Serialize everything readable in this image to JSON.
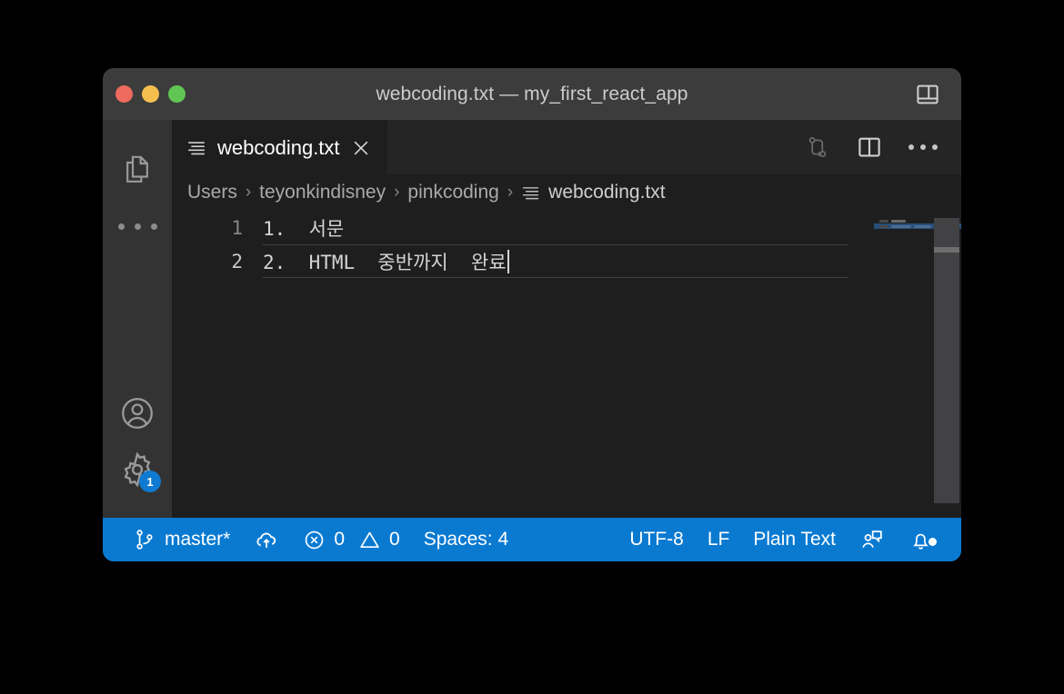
{
  "window": {
    "title": "webcoding.txt — my_first_react_app",
    "traffic_lights": [
      {
        "name": "close",
        "color": "#ed6a5e"
      },
      {
        "name": "minimize",
        "color": "#f5bf4f"
      },
      {
        "name": "maximize",
        "color": "#61c554"
      }
    ],
    "layout_toggle_icon": "panel-layout-icon"
  },
  "activity_bar": {
    "items": [
      {
        "name": "explorer",
        "icon": "files-icon"
      },
      {
        "name": "more-views",
        "icon": "ellipsis-icon"
      },
      {
        "name": "accounts",
        "icon": "account-icon"
      },
      {
        "name": "manage-settings",
        "icon": "gear-icon",
        "badge": "1"
      }
    ]
  },
  "tabs": {
    "active_index": 0,
    "items": [
      {
        "label": "webcoding.txt",
        "icon": "list-file-icon",
        "close_icon": "close-icon",
        "dirty": false
      }
    ],
    "actions": [
      {
        "name": "compare-changes",
        "icon": "source-control-compare-icon"
      },
      {
        "name": "split-editor",
        "icon": "split-editor-icon"
      },
      {
        "name": "more-actions",
        "icon": "ellipsis-icon"
      }
    ]
  },
  "breadcrumb": {
    "separator": "›",
    "items": [
      {
        "label": "Users",
        "icon": null
      },
      {
        "label": "teyonkindisney",
        "icon": null
      },
      {
        "label": "pinkcoding",
        "icon": null
      },
      {
        "label": "webcoding.txt",
        "icon": "list-file-icon"
      }
    ]
  },
  "editor": {
    "language": "Plain Text",
    "active_line": 2,
    "lines": [
      {
        "number": "1",
        "text": "1.  서문"
      },
      {
        "number": "2",
        "text": "2.  HTML  중반까지  완료"
      }
    ],
    "cursor": {
      "line": 2,
      "after_text": "2.  HTML  중반까지  완료"
    }
  },
  "minimap": {
    "selected_line": 2,
    "lines": [
      {
        "tokens": [
          14,
          22
        ]
      },
      {
        "tokens": [
          14,
          30,
          26,
          20
        ]
      }
    ]
  },
  "status_bar": {
    "left": [
      {
        "name": "branch",
        "icon": "source-control-branch-icon",
        "label": "master*"
      },
      {
        "name": "sync",
        "icon": "cloud-upload-icon",
        "label": ""
      },
      {
        "name": "problems",
        "icon": "error-warning-icon",
        "errors": "0",
        "warnings": "0"
      },
      {
        "name": "indentation",
        "icon": null,
        "label": "Spaces: 4"
      }
    ],
    "right": [
      {
        "name": "encoding",
        "icon": null,
        "label": "UTF-8"
      },
      {
        "name": "eol",
        "icon": null,
        "label": "LF"
      },
      {
        "name": "language-mode",
        "icon": null,
        "label": "Plain Text"
      },
      {
        "name": "feedback",
        "icon": "person-feedback-icon",
        "label": ""
      },
      {
        "name": "notifications",
        "icon": "bell-dot-icon",
        "label": ""
      }
    ],
    "background_color": "#0a7ad1"
  },
  "colors": {
    "titlebar": "#3c3c3c",
    "activitybar": "#333333",
    "tabbar": "#252526",
    "editor": "#1e1e1e",
    "statusbar": "#0a7ad1",
    "badge": "#0e7ad1",
    "minimap_selection": "#264f78"
  }
}
